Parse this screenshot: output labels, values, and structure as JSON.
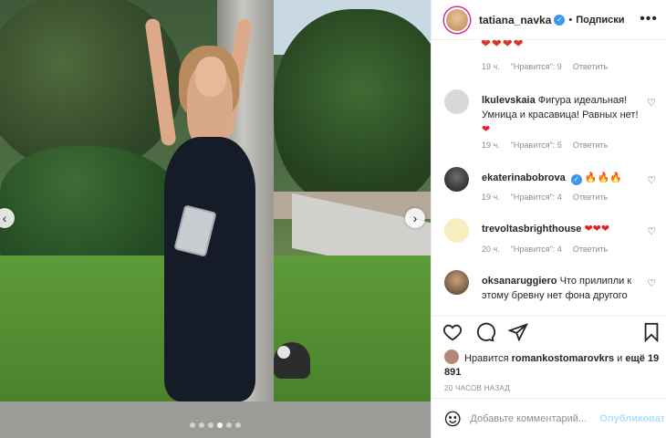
{
  "post": {
    "author": "tatiana_navka",
    "separator": "•",
    "follow_label": "Подписки",
    "more_label": "•••",
    "partial_emojis": "❤❤❤❤",
    "carousel": {
      "slide_count": 6,
      "active_index": 3
    }
  },
  "comments": [
    {
      "time": "19 ч.",
      "likes": "\"Нравится\": 9",
      "reply": "Ответить"
    },
    {
      "user": "lkulevskaia",
      "text": "Фигура идеальная! Умница и красавица! Равных нет!",
      "emoji": "❤",
      "time": "19 ч.",
      "likes": "\"Нравится\": 5",
      "reply": "Ответить"
    },
    {
      "user": "ekaterinabobrova",
      "emoji": "🔥🔥🔥",
      "time": "19 ч.",
      "likes": "\"Нравится\": 4",
      "reply": "Ответить"
    },
    {
      "user": "trevoltasbrighthouse",
      "emoji": "❤❤❤",
      "time": "20 ч.",
      "likes": "\"Нравится\": 4",
      "reply": "Ответить"
    },
    {
      "user": "oksanaruggiero",
      "text": "Что прилипли к этому бревну нет фона другого"
    }
  ],
  "likes": {
    "prefix": "Нравится",
    "user": "romankostomarovkrs",
    "conjunction": "и",
    "others": "ещё 19 891"
  },
  "time_ago": "20 ЧАСОВ НАЗАД",
  "add_comment": {
    "placeholder": "Добавьте комментарий...",
    "publish_label": "Опубликовать"
  },
  "colors": {
    "accent": "#3897f0",
    "heart": "#ed1c24",
    "muted": "#8e8e8e"
  }
}
